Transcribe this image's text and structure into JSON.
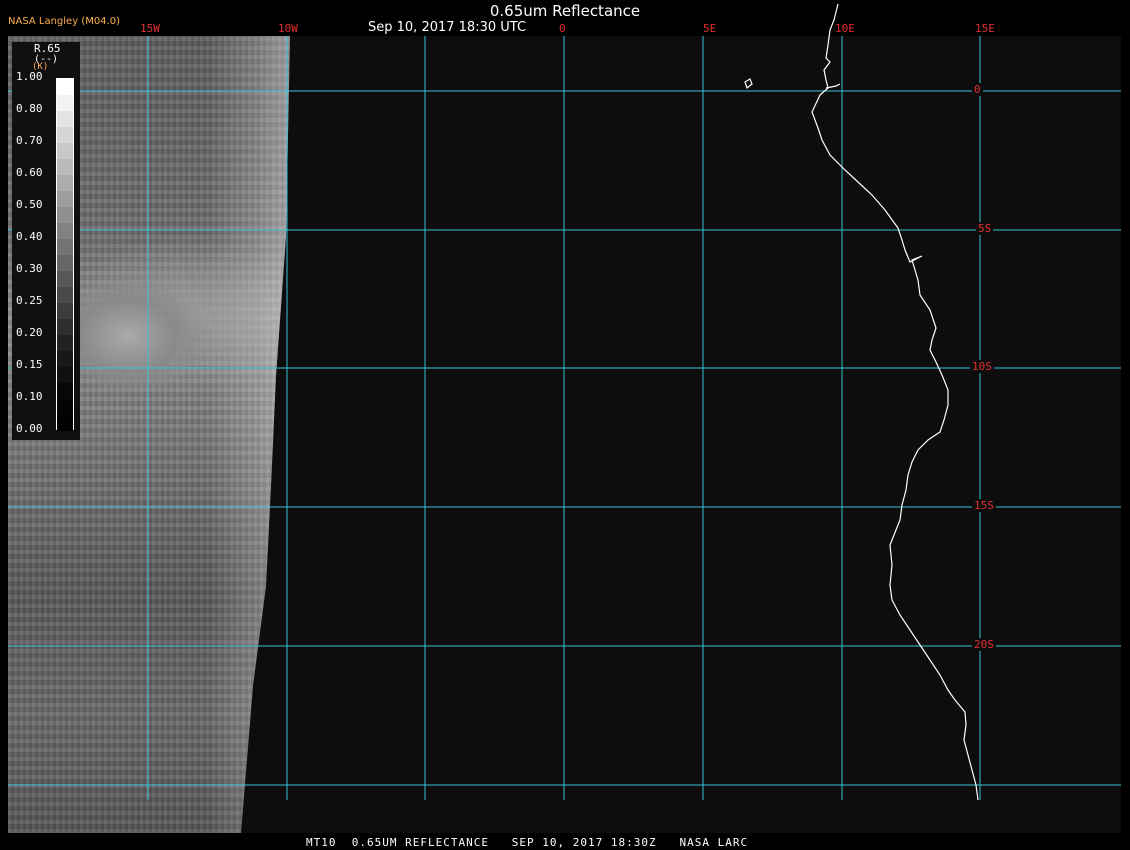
{
  "header": {
    "title": "0.65um Reflectance",
    "subtitle": "Sep 10, 2017 18:30 UTC",
    "org": "NASA Langley (M04.0)"
  },
  "legend": {
    "variable": "R.65",
    "unit": "(--)",
    "k_marker": "(K)",
    "ticks": [
      "1.00",
      "0.80",
      "0.70",
      "0.60",
      "0.50",
      "0.40",
      "0.30",
      "0.25",
      "0.20",
      "0.15",
      "0.10",
      "0.00"
    ]
  },
  "grid": {
    "lon_labels": [
      "15W",
      "10W",
      "0",
      "5E",
      "10E",
      "15E"
    ],
    "lat_labels": [
      "0",
      "5S",
      "10S",
      "15S",
      "20S"
    ],
    "grid_color": "#37c4d4",
    "label_color": "#e23030"
  },
  "footer": {
    "text": "MT10  0.65UM REFLECTANCE   SEP 10, 2017 18:30Z   NASA LARC"
  },
  "colors": {
    "coastline": "#ffffff",
    "ocean_background": "#0d0d0d",
    "org_label": "#ffb04d"
  }
}
